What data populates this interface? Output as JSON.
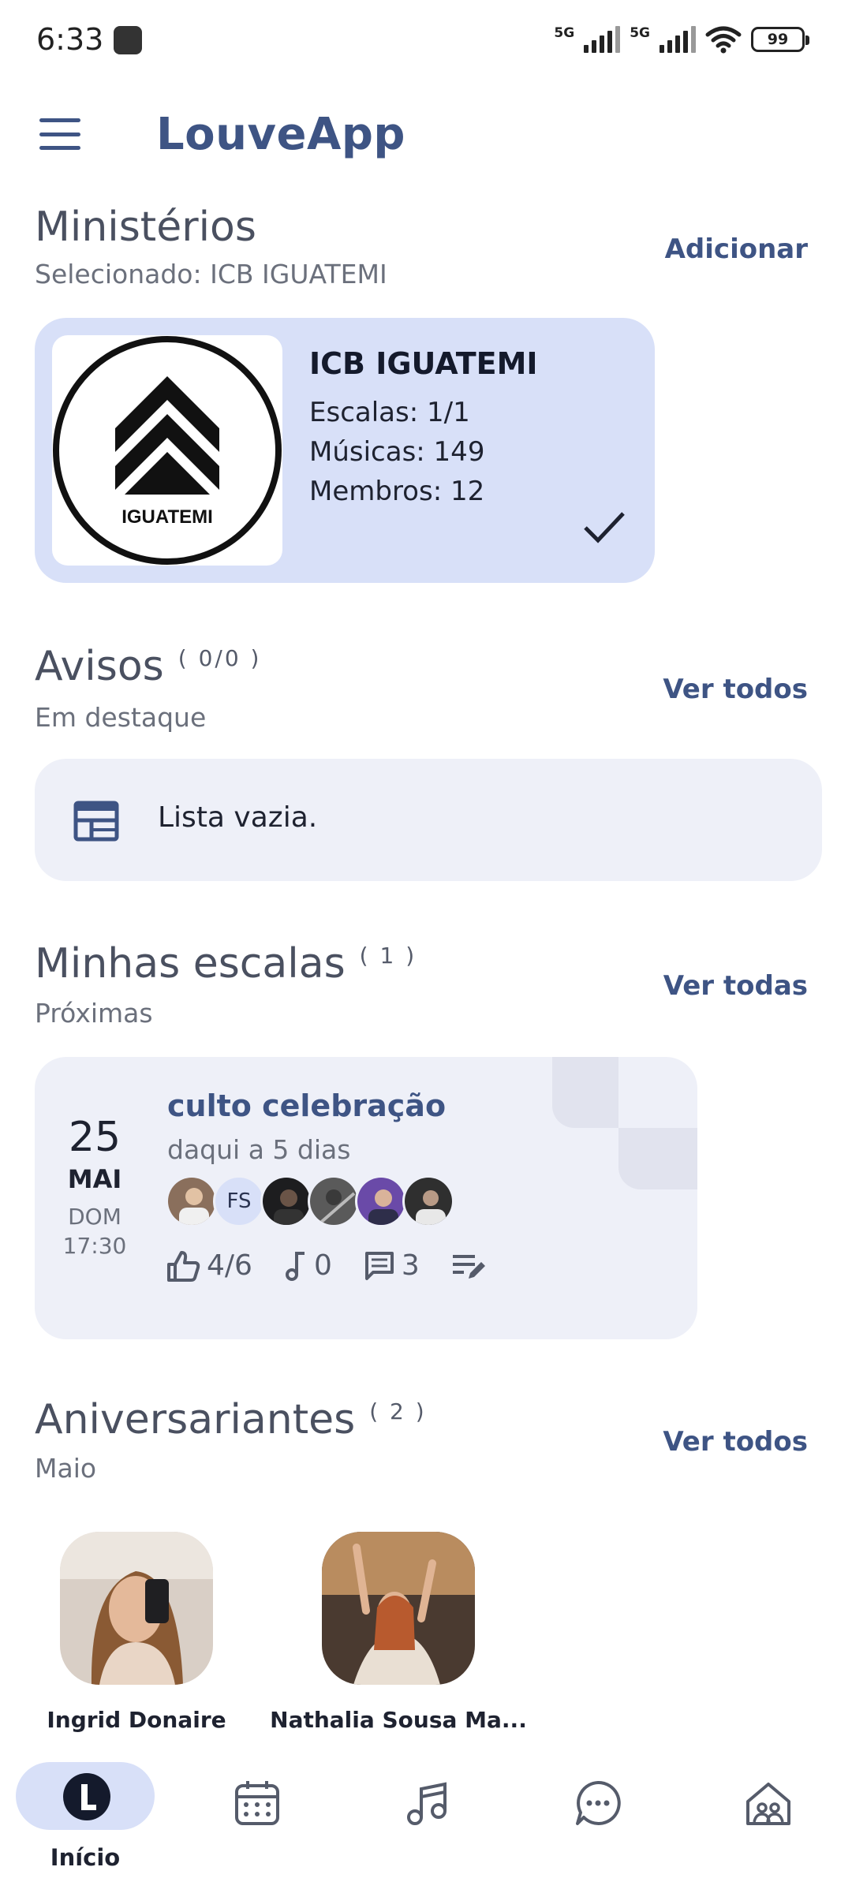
{
  "status_bar": {
    "time": "6:33",
    "network_1": "5G",
    "network_2": "5G",
    "battery": "99"
  },
  "app": {
    "title": "LouveApp"
  },
  "ministerios": {
    "title": "Ministérios",
    "subtitle": "Selecionado: ICB IGUATEMI",
    "action": "Adicionar",
    "card": {
      "name": "ICB IGUATEMI",
      "logo_text": "IGUATEMI",
      "escalas": "Escalas: 1/1",
      "musicas": "Músicas: 149",
      "membros": "Membros: 12",
      "selected": true
    }
  },
  "avisos": {
    "title": "Avisos",
    "count": "( 0/0 )",
    "subtitle": "Em destaque",
    "action": "Ver todos",
    "empty_text": "Lista vazia."
  },
  "escalas": {
    "title": "Minhas escalas",
    "count": "( 1 )",
    "subtitle": "Próximas",
    "action": "Ver todas",
    "item": {
      "day": "25",
      "month": "MAI",
      "weekday": "DOM",
      "time": "17:30",
      "title": "culto celebração",
      "subtitle": "daqui a 5 dias",
      "avatar_initials": "FS",
      "likes": "4/6",
      "songs": "0",
      "comments": "3"
    }
  },
  "aniversariantes": {
    "title": "Aniversariantes",
    "count": "( 2 )",
    "subtitle": "Maio",
    "action": "Ver todos",
    "people": [
      {
        "name": "Ingrid Donaire"
      },
      {
        "name": "Nathalia Sousa Ma..."
      }
    ]
  },
  "bottom_nav": {
    "items": [
      {
        "label": "Início",
        "icon": "home-logo-icon",
        "active": true
      },
      {
        "label": "",
        "icon": "calendar-icon"
      },
      {
        "label": "",
        "icon": "music-note-icon"
      },
      {
        "label": "",
        "icon": "chat-icon"
      },
      {
        "label": "",
        "icon": "group-home-icon"
      }
    ]
  },
  "colors": {
    "primary": "#3e5484",
    "card_selected": "#d8e0f8",
    "card_neutral": "#eef0f8"
  }
}
